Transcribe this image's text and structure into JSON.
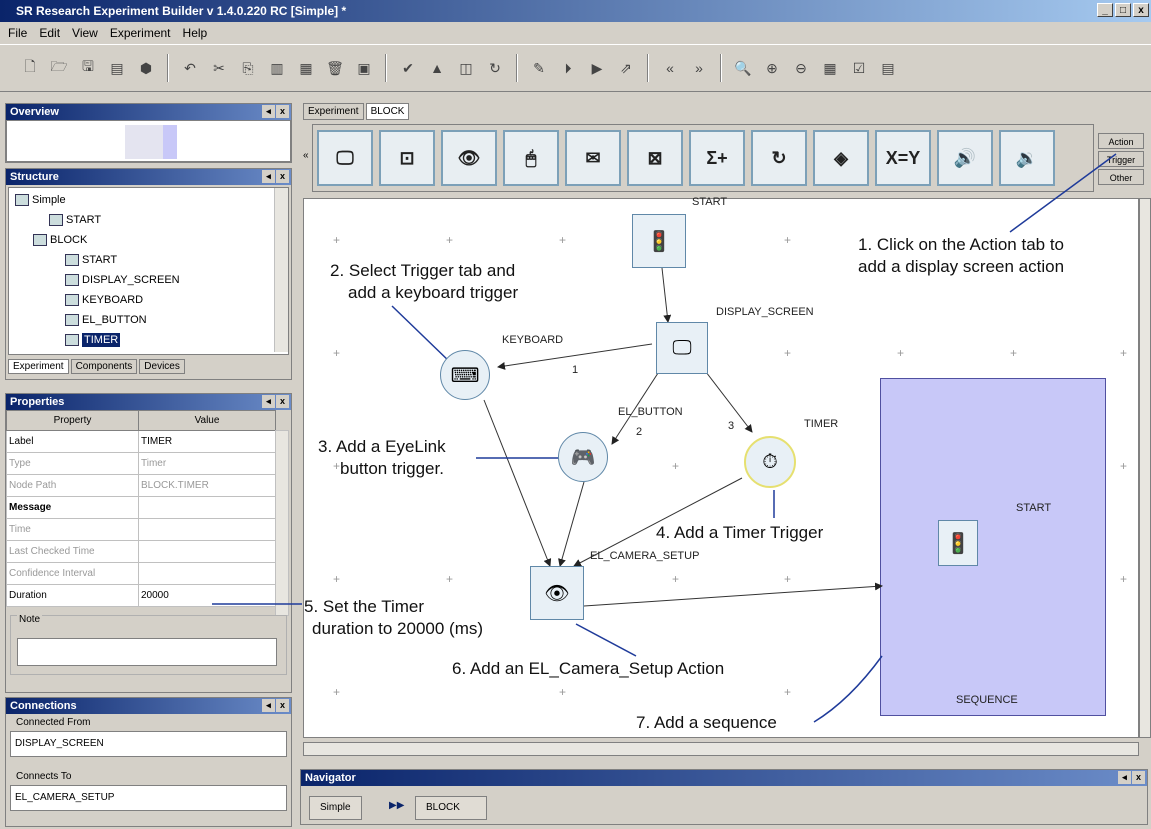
{
  "window": {
    "title": "SR Research Experiment Builder v 1.4.0.220 RC [Simple] *",
    "controls": [
      "_",
      "□",
      "x"
    ]
  },
  "menu": [
    "File",
    "Edit",
    "View",
    "Experiment",
    "Help"
  ],
  "overview": {
    "title": "Overview"
  },
  "structure": {
    "title": "Structure",
    "items": [
      "Simple",
      "START",
      "BLOCK",
      "START",
      "DISPLAY_SCREEN",
      "KEYBOARD",
      "EL_BUTTON",
      "TIMER"
    ],
    "tabs": [
      "Experiment",
      "Components",
      "Devices"
    ]
  },
  "properties": {
    "title": "Properties",
    "headers": [
      "Property",
      "Value"
    ],
    "rows": [
      {
        "property": "Label",
        "value": "TIMER"
      },
      {
        "property": "Type",
        "value": "Timer"
      },
      {
        "property": "Node Path",
        "value": "BLOCK.TIMER"
      },
      {
        "property": "Message",
        "value": ""
      },
      {
        "property": "Time",
        "value": ""
      },
      {
        "property": "Last Checked Time",
        "value": ""
      },
      {
        "property": "Confidence Interval",
        "value": ""
      },
      {
        "property": "Duration",
        "value": "20000"
      }
    ],
    "note_label": "Note"
  },
  "connections": {
    "title": "Connections",
    "from_label": "Connected From",
    "from_value": "DISPLAY_SCREEN",
    "to_label": "Connects To",
    "to_value": "EL_CAMERA_SETUP"
  },
  "editor": {
    "tabs": [
      "Experiment",
      "BLOCK"
    ],
    "side_tabs": [
      "Action",
      "Trigger",
      "Other"
    ],
    "palette_text": [
      "Σ+",
      "X=Y"
    ]
  },
  "nodes": {
    "start": "START",
    "display_screen": "DISPLAY_SCREEN",
    "keyboard": "KEYBOARD",
    "el_button": "EL_BUTTON",
    "timer": "TIMER",
    "el_camera_setup": "EL_CAMERA_SETUP",
    "sequence_start": "START",
    "sequence": "SEQUENCE",
    "edge1": "1",
    "edge2": "2",
    "edge3": "3"
  },
  "annotations": {
    "a1_line1": "1. Click on the Action tab to",
    "a1_line2": "add a display screen action",
    "a2_line1": "2. Select Trigger tab and",
    "a2_line2": "add a keyboard trigger",
    "a3_line1": "3. Add a EyeLink",
    "a3_line2": "button trigger.",
    "a4": "4. Add a Timer Trigger",
    "a5_line1": "5. Set the Timer",
    "a5_line2": "duration to 20000 (ms)",
    "a6": "6. Add an EL_Camera_Setup Action",
    "a7": "7. Add a sequence"
  },
  "navigator": {
    "title": "Navigator",
    "crumbs": [
      "Simple",
      "BLOCK"
    ],
    "separator": "▶▶"
  }
}
